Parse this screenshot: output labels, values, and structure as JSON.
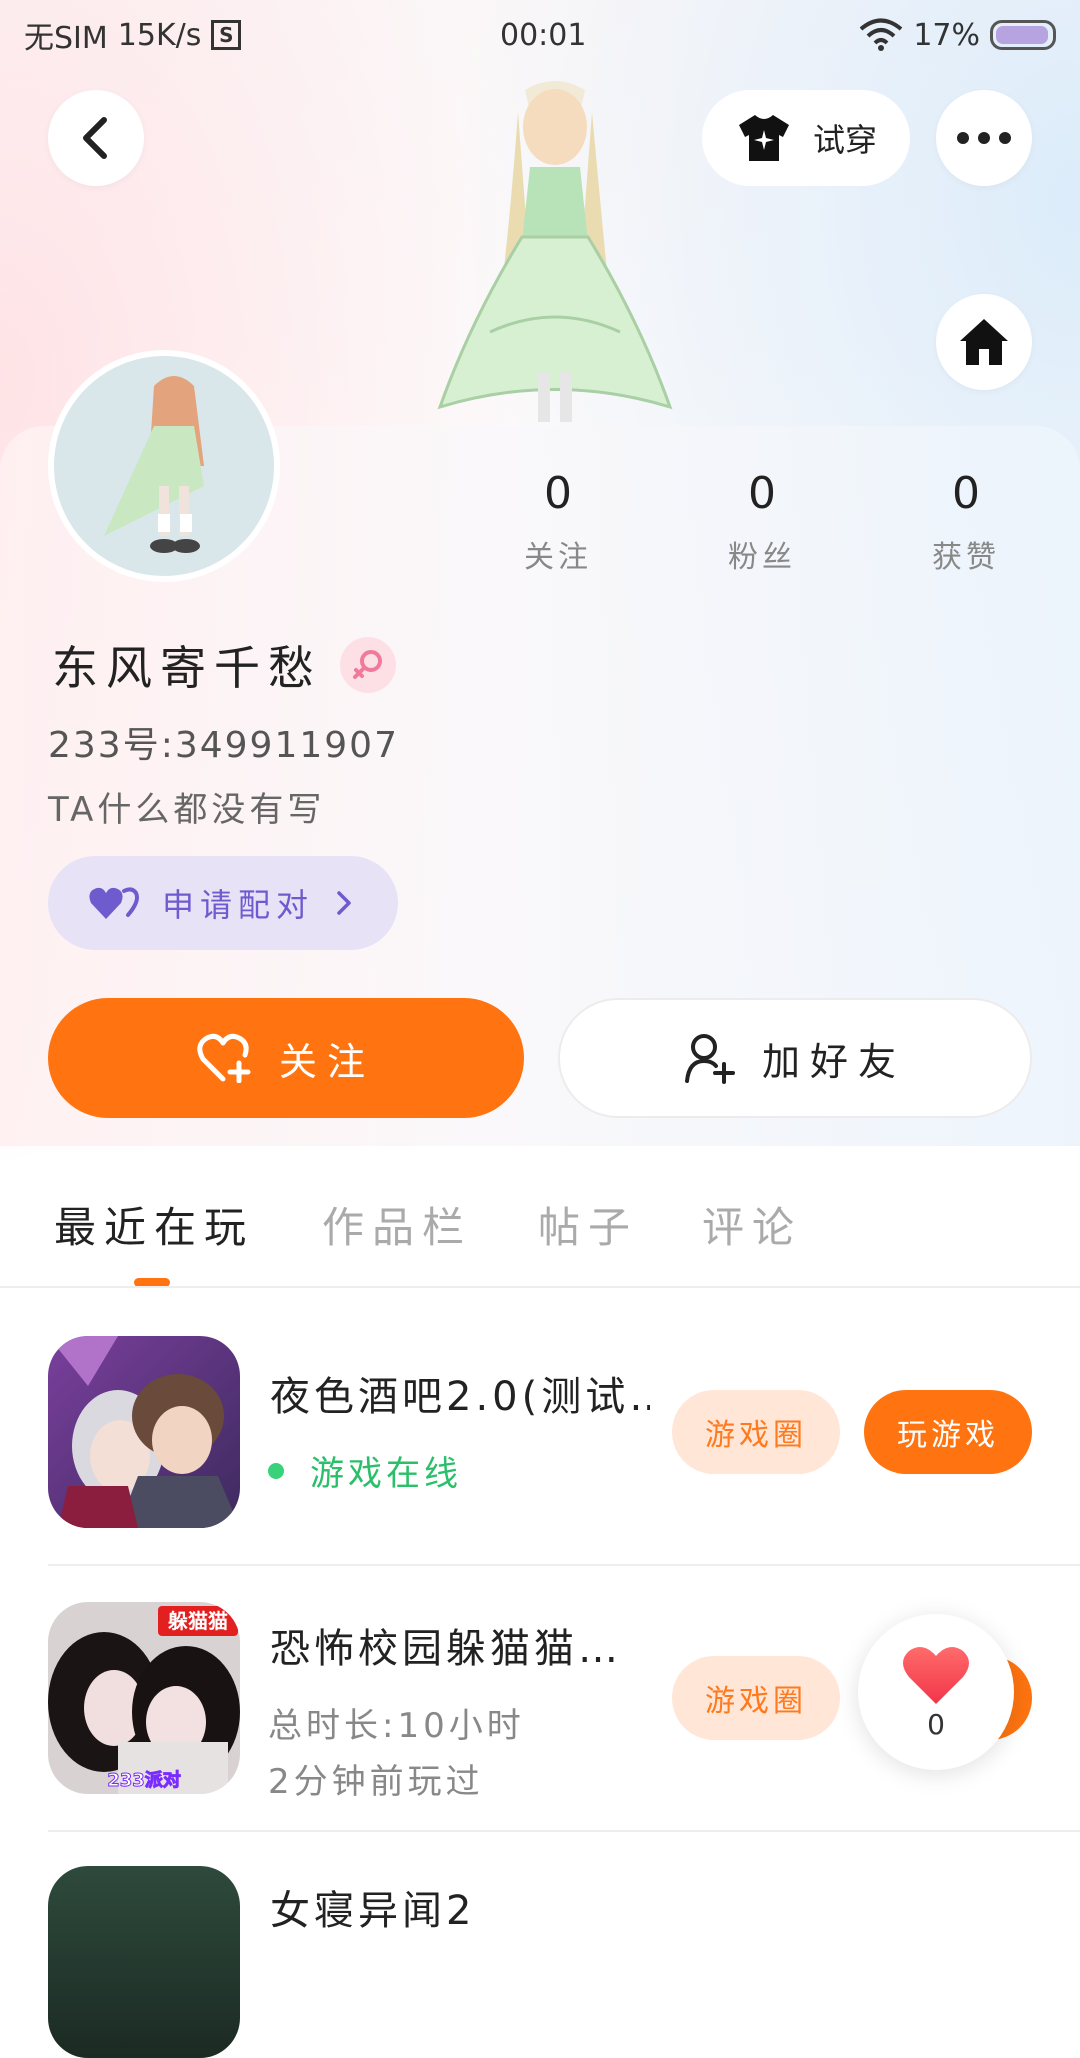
{
  "status_bar": {
    "carrier": "无SIM",
    "speed": "15K/s",
    "sim_icon_label": "S",
    "time": "00:01",
    "battery": "17%",
    "battery_level": 0.17
  },
  "header": {
    "try_on_label": "试穿"
  },
  "stats": [
    {
      "value": "0",
      "label": "关注"
    },
    {
      "value": "0",
      "label": "粉丝"
    },
    {
      "value": "0",
      "label": "获赞"
    }
  ],
  "profile": {
    "name": "东风寄千愁",
    "uid": "233号:349911907",
    "bio": "TA什么都没有写",
    "pair_label": "申请配对"
  },
  "actions": {
    "follow_label": "关注",
    "add_friend_label": "加好友"
  },
  "tabs": [
    "最近在玩",
    "作品栏",
    "帖子",
    "评论"
  ],
  "games": [
    {
      "title": "夜色酒吧2.0(测试…",
      "status": "游戏在线",
      "circle_label": "游戏圈",
      "play_label": "玩游戏"
    },
    {
      "title": "恐怖校园躲猫猫…",
      "duration": "总时长:10小时",
      "last_played": "2分钟前玩过",
      "circle_label": "游戏圈",
      "icon_text": "躲猫猫",
      "icon_sub": "233派对"
    },
    {
      "title": "女寝异闻2"
    }
  ],
  "like": {
    "count": "0"
  },
  "colors": {
    "accent": "#ff7410",
    "pair": "#6e5ccf",
    "online": "#2bbf6a"
  }
}
